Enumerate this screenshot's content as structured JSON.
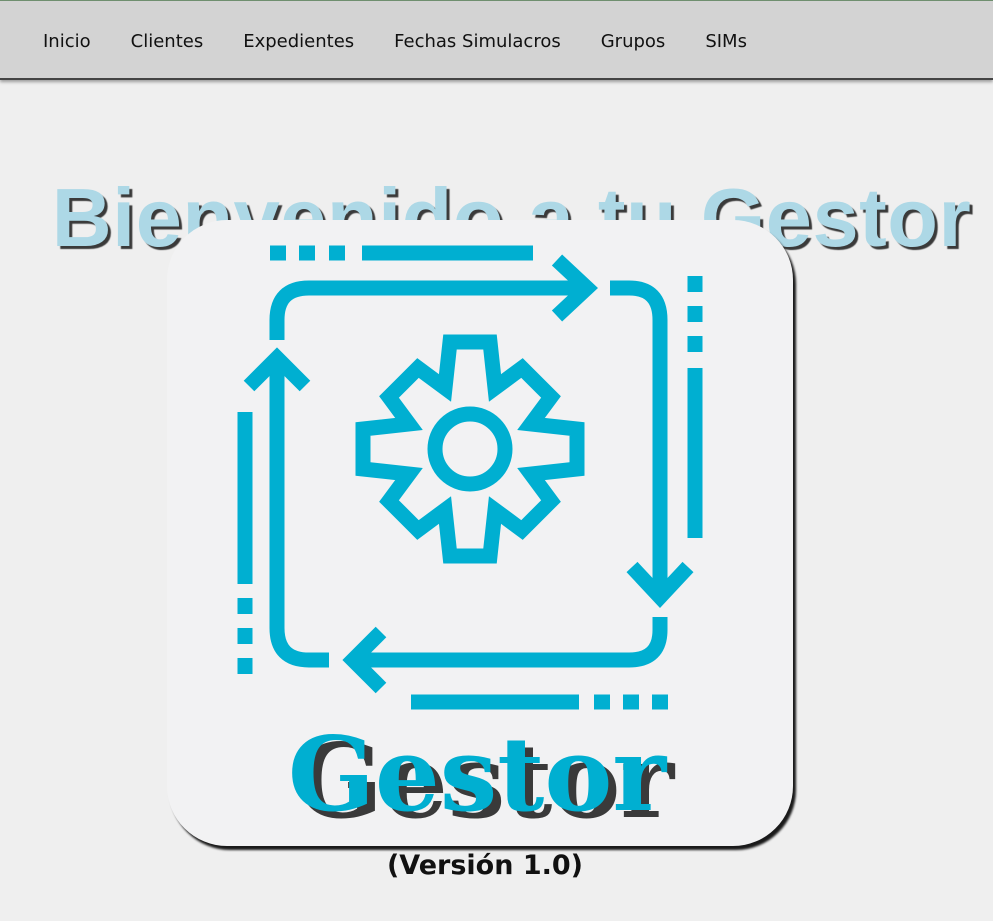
{
  "nav": {
    "items": [
      {
        "label": "Inicio"
      },
      {
        "label": "Clientes"
      },
      {
        "label": "Expedientes"
      },
      {
        "label": "Fechas Simulacros"
      },
      {
        "label": "Grupos"
      },
      {
        "label": "SIMs"
      }
    ]
  },
  "main": {
    "title": "Bienvenido a tu Gestor",
    "logo": {
      "icon": "gear-cycle-icon",
      "text": "Gestor",
      "accent_color": "#00afd1"
    },
    "version": "(Versión 1.0)"
  }
}
